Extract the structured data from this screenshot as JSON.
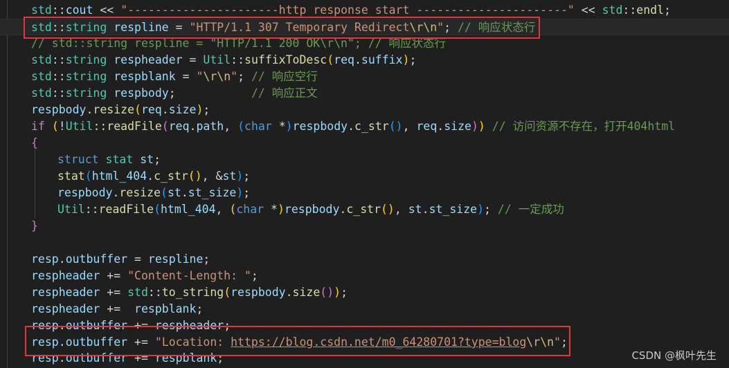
{
  "editor": {
    "watermark": "CSDN @枫叶先生"
  },
  "lines": {
    "l0": "std::cout << \"----------------------http response start ----------------------\" << std::endl;",
    "l1": "std::string respline = \"HTTP/1.1 307 Temporary Redirect\\r\\n\"; // 响应状态行",
    "l2": "// std::string respline = \"HTTP/1.1 200 OK\\r\\n\"; // 响应状态行",
    "l3": "std::string respheader = Util::suffixToDesc(req.suffix);",
    "l4": "std::string respblank = \"\\r\\n\"; // 响应空行",
    "l5": "std::string respbody;           // 响应正文",
    "l6": "respbody.resize(req.size);",
    "l7": "if (!Util::readFile(req.path, (char *)respbody.c_str(), req.size)) // 访问资源不存在，打开404html",
    "l8": "{",
    "l9": "struct stat st;",
    "l10": "stat(html_404.c_str(), &st);",
    "l11": "respbody.resize(st.st_size);",
    "l12": "Util::readFile(html_404, (char *)respbody.c_str(), st.st_size); // 一定成功",
    "l13": "}",
    "l14": "resp.outbuffer = respline;",
    "l15": "respheader += \"Content-Length: \";",
    "l16": "respheader += std::to_string(respbody.size());",
    "l17": "respheader +=  respblank;",
    "l18": "resp.outbuffer += respheader;",
    "l19": "resp.outbuffer += \"Location: https://blog.csdn.net/m0_64280701?type=blog\\r\\n\";",
    "l20": "resp.outbuffer += respblank;"
  },
  "tokens": {
    "std": "std",
    "cout": "cout",
    "endl": "endl",
    "string": "string",
    "respline": "respline",
    "respheader": "respheader",
    "respblank": "respblank",
    "respbody": "respbody",
    "util": "Util",
    "suffixToDesc": "suffixToDesc",
    "req": "req",
    "suffix": "suffix",
    "resize": "resize",
    "size": "size",
    "if": "if",
    "readFile": "readFile",
    "path": "path",
    "char": "char",
    "c_str": "c_str",
    "struct": "struct",
    "stat": "stat",
    "st": "st",
    "html_404": "html_404",
    "st_size": "st_size",
    "resp": "resp",
    "outbuffer": "outbuffer",
    "to_string": "to_string",
    "start_str": "\"----------------------http response start ----------------------\"",
    "status_str": "\"HTTP/1.1 307 Temporary Redirect",
    "esc_rn": "\\r\\n",
    "quote": "\"",
    "status_cmt": "// 响应状态行",
    "old_status": "// std::string respline = \"HTTP/1.1 200 OK\\r\\n\"; // 响应状态行",
    "blank_cmt": "// 响应空行",
    "body_cmt": "// 响应正文",
    "open404_cmt": "// 访问资源不存在，打开404html",
    "success_cmt": "// 一定成功",
    "content_length_str": "\"Content-Length: \"",
    "location_prefix": "\"Location: ",
    "location_url": "https://blog.csdn.net/m0_64280701?type=blog"
  }
}
